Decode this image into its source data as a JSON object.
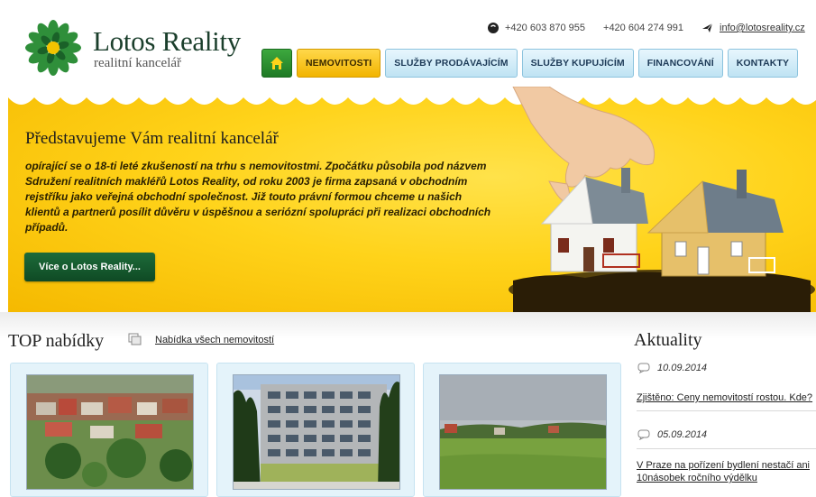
{
  "brand": {
    "name": "Lotos Reality",
    "subtitle": "realitní kancelář"
  },
  "contact": {
    "phone1": "+420 603 870 955",
    "phone2": "+420 604 274 991",
    "email": "info@lotosreality.cz"
  },
  "nav": {
    "items": [
      {
        "label": "NEMOVITOSTI",
        "state": "active"
      },
      {
        "label": "SLUŽBY PRODÁVAJÍCÍM",
        "state": "default"
      },
      {
        "label": "SLUŽBY KUPUJÍCÍM",
        "state": "default"
      },
      {
        "label": "FINANCOVÁNÍ",
        "state": "default"
      },
      {
        "label": "KONTAKTY",
        "state": "default"
      }
    ]
  },
  "hero": {
    "title": "Představujeme Vám realitní kancelář",
    "text": "opírající se o 18-ti leté zkušeností na trhu s nemovitostmi. Zpočátku působila pod názvem Sdružení realitních makléřů Lotos Reality, od roku 2003 je firma zapsaná v obchodním rejstříku jako veřejná obchodní společnost. Již touto právní formou chceme u našich klientů a partnerů posílit důvěru v úspěšnou a seriózní spolupráci při realizaci obchodních případů.",
    "button": "Více o Lotos Reality..."
  },
  "top_offers": {
    "title": "TOP nabídky",
    "all_link": "Nabídka všech nemovitostí",
    "cards": [
      {
        "photo": "village-aerial"
      },
      {
        "photo": "apartment-block"
      },
      {
        "photo": "green-field"
      }
    ]
  },
  "news": {
    "title": "Aktuality",
    "items": [
      {
        "date": "10.09.2014",
        "headline": "Zjištěno: Ceny nemovitostí rostou. Kde?"
      },
      {
        "date": "05.09.2014",
        "headline": "V Praze na pořízení bydlení nestačí ani 10násobek ročního výdělku"
      }
    ]
  },
  "colors": {
    "accent_yellow": "#ffd31a",
    "button_green": "#1d6b3a",
    "nav_blue": "#bfe3f3"
  }
}
